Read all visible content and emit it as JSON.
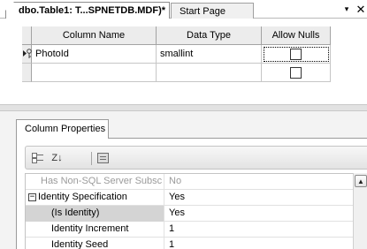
{
  "tabs": [
    {
      "label": "dbo.Table1: T...SPNETDB.MDF)*",
      "active": true
    },
    {
      "label": "Start Page",
      "active": false
    }
  ],
  "tab_strip": {
    "dropdown_glyph": "▾",
    "close_glyph": "✕"
  },
  "table_grid": {
    "columns": [
      "Column Name",
      "Data Type",
      "Allow Nulls"
    ],
    "rows": [
      {
        "column_name": "PhotoId",
        "data_type": "smallint",
        "allow_nulls": false,
        "primary_key": true,
        "current": true
      },
      {
        "column_name": "",
        "data_type": "",
        "allow_nulls": false,
        "primary_key": false,
        "current": false
      }
    ],
    "row_marker_glyph": "▶"
  },
  "column_properties": {
    "tab_label": "Column Properties",
    "toolbar": {
      "categorized_icon": "categorized-icon",
      "alphabetical_icon": "sort-az-icon",
      "alphabetical_glyph": "Z↓",
      "property_pages_icon": "property-pages-icon"
    },
    "rows": [
      {
        "name": "Has Non-SQL Server Subsc",
        "value": "No",
        "kind": "disabled"
      },
      {
        "name": "Identity Specification",
        "value": "Yes",
        "kind": "category",
        "expander": "−"
      },
      {
        "name": "(Is Identity)",
        "value": "Yes",
        "kind": "child-selected"
      },
      {
        "name": "Identity Increment",
        "value": "1",
        "kind": "child"
      },
      {
        "name": "Identity Seed",
        "value": "1",
        "kind": "child"
      }
    ],
    "scroll_up_glyph": "▲"
  }
}
